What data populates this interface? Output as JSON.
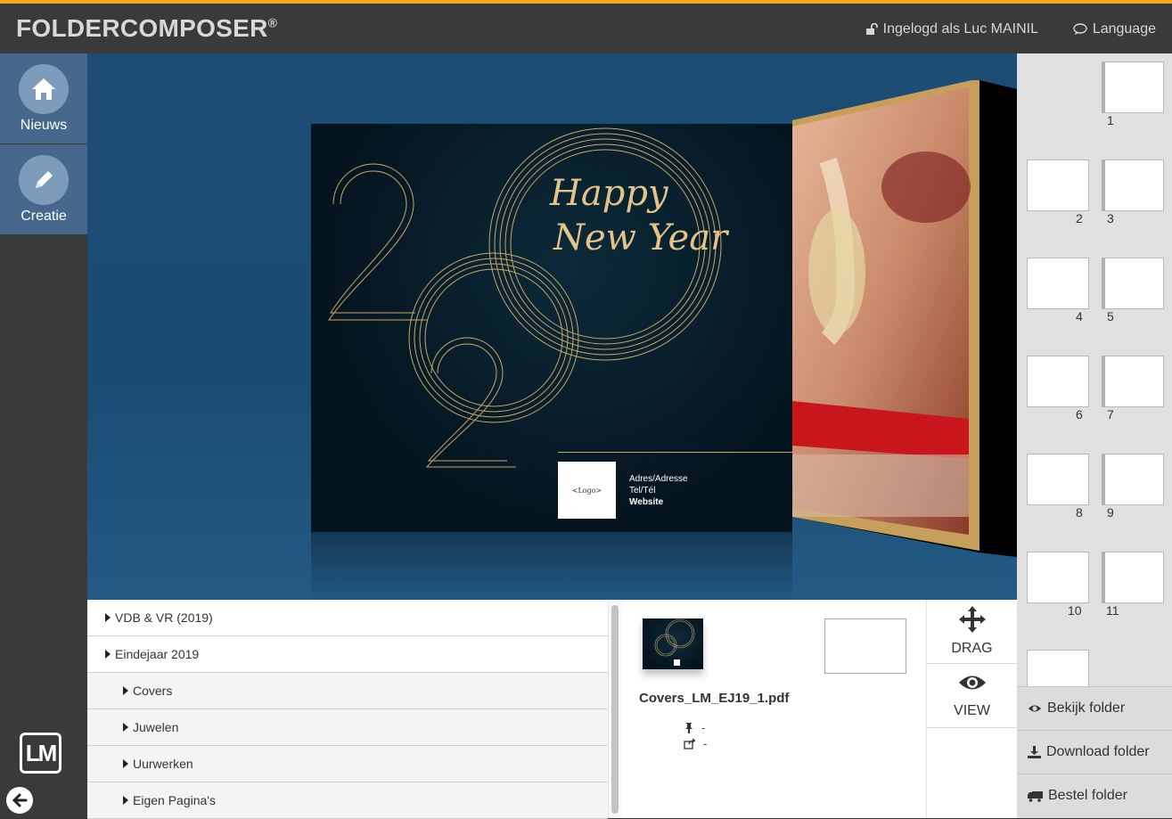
{
  "header": {
    "brand": "FOLDERCOMPOSER",
    "brand_mark": "®",
    "login_text": "Ingelogd als Luc MAINIL",
    "language_label": "Language",
    "accent_color": "#f0a818"
  },
  "leftnav": {
    "items": [
      {
        "label": "Nieuws",
        "icon": "home-icon"
      },
      {
        "label": "Creatie",
        "icon": "pencil-icon"
      }
    ],
    "logo_text": "LM",
    "active_color": "#45688c"
  },
  "cover": {
    "title_line1": "Happy",
    "title_line2": "New Year",
    "logo_placeholder": "<Logo>",
    "address_line": "Adres/Adresse",
    "phone_line": "Tel/Tél",
    "website_line": "Website"
  },
  "tree": {
    "items": [
      {
        "label": "VDB & VR (2019)",
        "level": 0
      },
      {
        "label": "Eindejaar 2019",
        "level": 0
      },
      {
        "label": "Covers",
        "level": 1
      },
      {
        "label": "Juwelen",
        "level": 1
      },
      {
        "label": "Uurwerken",
        "level": 1
      },
      {
        "label": "Eigen Pagina's",
        "level": 1
      }
    ]
  },
  "detail": {
    "filename": "Covers_LM_EJ19_1.pdf",
    "pin_value": "-",
    "share_value": "-"
  },
  "tools": {
    "drag_label": "DRAG",
    "view_label": "VIEW"
  },
  "pages": {
    "numbers": [
      "1",
      "2",
      "3",
      "4",
      "5",
      "6",
      "7",
      "8",
      "9",
      "10",
      "11"
    ]
  },
  "actions": {
    "view_folder": "Bekijk folder",
    "download_folder": "Download folder",
    "order_folder": "Bestel folder"
  }
}
